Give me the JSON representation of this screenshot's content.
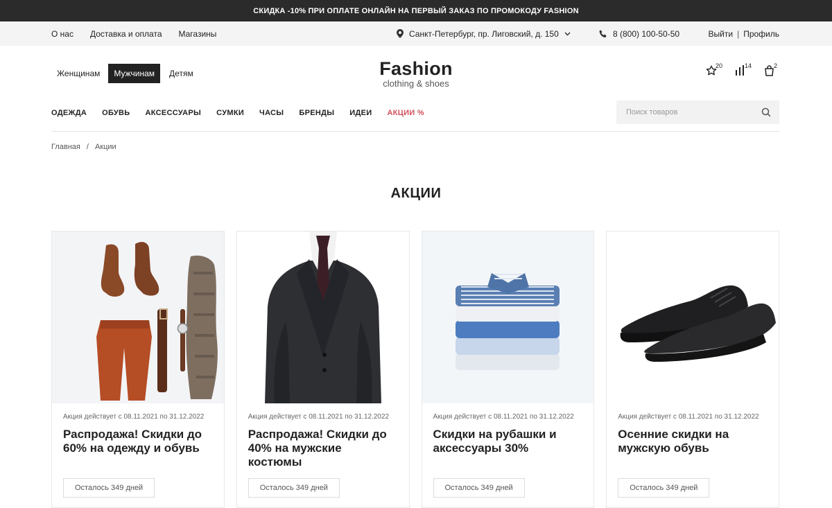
{
  "promo": {
    "text": "СКИДКА -10% ПРИ ОПЛАТЕ ОНЛАЙН НА ПЕРВЫЙ ЗАКАЗ ПО ПРОМОКОДУ FASHION"
  },
  "topbar": {
    "links": [
      "О нас",
      "Доставка и оплата",
      "Магазины"
    ],
    "address": "Санкт-Петербург, пр. Лиговский, д. 150",
    "phone": "8 (800) 100-50-50",
    "logout": "Выйти",
    "separator": "|",
    "profile": "Профиль"
  },
  "gender_tabs": [
    {
      "label": "Женщинам"
    },
    {
      "label": "Мужчинам"
    },
    {
      "label": "Детям"
    }
  ],
  "logo": {
    "brand": "Fashion",
    "sub": "clothing & shoes"
  },
  "header_icons": {
    "favorites_count": "20",
    "compare_count": "14",
    "cart_count": "2"
  },
  "main_nav": [
    "ОДЕЖДА",
    "ОБУВЬ",
    "АКСЕССУАРЫ",
    "СУМКИ",
    "ЧАСЫ",
    "БРЕНДЫ",
    "ИДЕИ",
    "АКЦИИ %"
  ],
  "search": {
    "placeholder": "Поиск товаров"
  },
  "breadcrumb": {
    "home": "Главная",
    "sep": "/",
    "current": "Акции"
  },
  "page_title": "АКЦИИ",
  "cards": [
    {
      "image": "flatlay-clothes-shoes",
      "date": "Акция действует с 08.11.2021 по 31.12.2022",
      "title": "Распродажа! Скидки до 60% на одежду и обувь",
      "days_left": "Осталось 349 дней"
    },
    {
      "image": "mens-suit",
      "date": "Акция действует с 08.11.2021 по 31.12.2022",
      "title": "Распродажа! Скидки до 40% на мужские костюмы",
      "days_left": "Осталось 349 дней"
    },
    {
      "image": "folded-shirts",
      "date": "Акция действует с 08.11.2021 по 31.12.2022",
      "title": "Скидки на рубашки и аксессуары 30%",
      "days_left": "Осталось 349 дней"
    },
    {
      "image": "black-leather-shoes",
      "date": "Акция действует с 08.11.2021 по 31.12.2022",
      "title": "Осенние скидки на мужскую обувь",
      "days_left": "Осталось 349 дней"
    }
  ],
  "colors": {
    "promo_bg": "#2b2b2b",
    "topbar_bg": "#f4f4f4",
    "sale_accent": "#d2515a",
    "active_tab_bg": "#222222"
  }
}
